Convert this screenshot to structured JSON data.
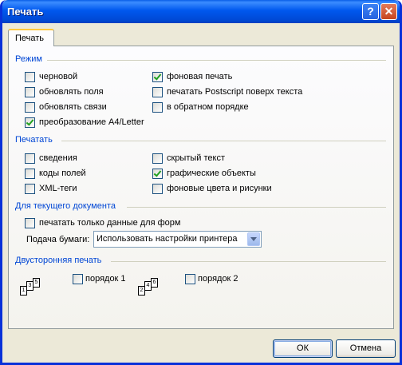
{
  "window": {
    "title": "Печать",
    "help_symbol": "?",
    "close_symbol": "✕"
  },
  "tab": {
    "label": "Печать"
  },
  "mode": {
    "title": "Режим",
    "items": [
      {
        "label": "черновой",
        "checked": false
      },
      {
        "label": "обновлять поля",
        "checked": false
      },
      {
        "label": "обновлять связи",
        "checked": false
      },
      {
        "label": "преобразование A4/Letter",
        "checked": true
      },
      {
        "label": "фоновая печать",
        "checked": true
      },
      {
        "label": "печатать Postscript поверх текста",
        "checked": false
      },
      {
        "label": "в обратном порядке",
        "checked": false
      }
    ]
  },
  "print": {
    "title": "Печатать",
    "items": [
      {
        "label": "сведения",
        "checked": false
      },
      {
        "label": "коды полей",
        "checked": false
      },
      {
        "label": "XML-теги",
        "checked": false
      },
      {
        "label": "скрытый текст",
        "checked": false
      },
      {
        "label": "графические объекты",
        "checked": true
      },
      {
        "label": "фоновые цвета и рисунки",
        "checked": false
      }
    ]
  },
  "current_doc": {
    "title": "Для текущего документа",
    "form_data_only": {
      "label": "печатать только данные для форм",
      "checked": false
    },
    "paper_feed": {
      "label": "Подача бумаги:",
      "value": "Использовать настройки принтера"
    }
  },
  "duplex": {
    "title": "Двусторонняя печать",
    "order1": {
      "label": "порядок 1",
      "checked": false,
      "pages": [
        "1",
        "3",
        "5"
      ]
    },
    "order2": {
      "label": "порядок 2",
      "checked": false,
      "pages": [
        "2",
        "4",
        "6"
      ]
    }
  },
  "buttons": {
    "ok": "ОК",
    "cancel": "Отмена"
  },
  "colors": {
    "title_bar": "#0058EE",
    "group_heading": "#0046D5",
    "check_mark": "#21A121",
    "dialog_bg": "#ECE9D8"
  }
}
